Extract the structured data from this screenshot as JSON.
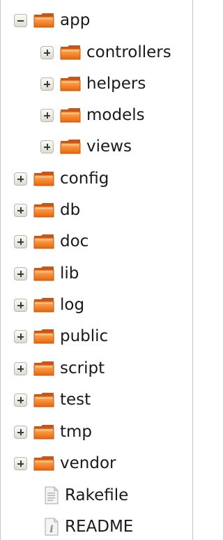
{
  "tree": {
    "items": [
      {
        "label": "app",
        "state": "expanded",
        "kind": "folder",
        "icon": "folder-icon"
      },
      {
        "label": "controllers",
        "state": "collapsed",
        "kind": "folder",
        "icon": "folder-icon"
      },
      {
        "label": "helpers",
        "state": "collapsed",
        "kind": "folder",
        "icon": "folder-icon"
      },
      {
        "label": "models",
        "state": "collapsed",
        "kind": "folder",
        "icon": "folder-icon"
      },
      {
        "label": "views",
        "state": "collapsed",
        "kind": "folder",
        "icon": "folder-icon"
      },
      {
        "label": "config",
        "state": "collapsed",
        "kind": "folder",
        "icon": "folder-icon"
      },
      {
        "label": "db",
        "state": "collapsed",
        "kind": "folder",
        "icon": "folder-icon"
      },
      {
        "label": "doc",
        "state": "collapsed",
        "kind": "folder",
        "icon": "folder-icon"
      },
      {
        "label": "lib",
        "state": "collapsed",
        "kind": "folder",
        "icon": "folder-icon"
      },
      {
        "label": "log",
        "state": "collapsed",
        "kind": "folder",
        "icon": "folder-icon"
      },
      {
        "label": "public",
        "state": "collapsed",
        "kind": "folder",
        "icon": "folder-icon"
      },
      {
        "label": "script",
        "state": "collapsed",
        "kind": "folder",
        "icon": "folder-icon"
      },
      {
        "label": "test",
        "state": "collapsed",
        "kind": "folder",
        "icon": "folder-icon"
      },
      {
        "label": "tmp",
        "state": "collapsed",
        "kind": "folder",
        "icon": "folder-icon"
      },
      {
        "label": "vendor",
        "state": "collapsed",
        "kind": "folder",
        "icon": "folder-icon"
      },
      {
        "label": "Rakefile",
        "state": "leaf",
        "kind": "file",
        "icon": "text-file-icon"
      },
      {
        "label": "README",
        "state": "leaf",
        "kind": "file",
        "icon": "info-file-icon"
      }
    ]
  },
  "colors": {
    "folder_front": "#f07a12",
    "folder_back": "#c8561a",
    "toggle_border": "#b9b6ad"
  }
}
